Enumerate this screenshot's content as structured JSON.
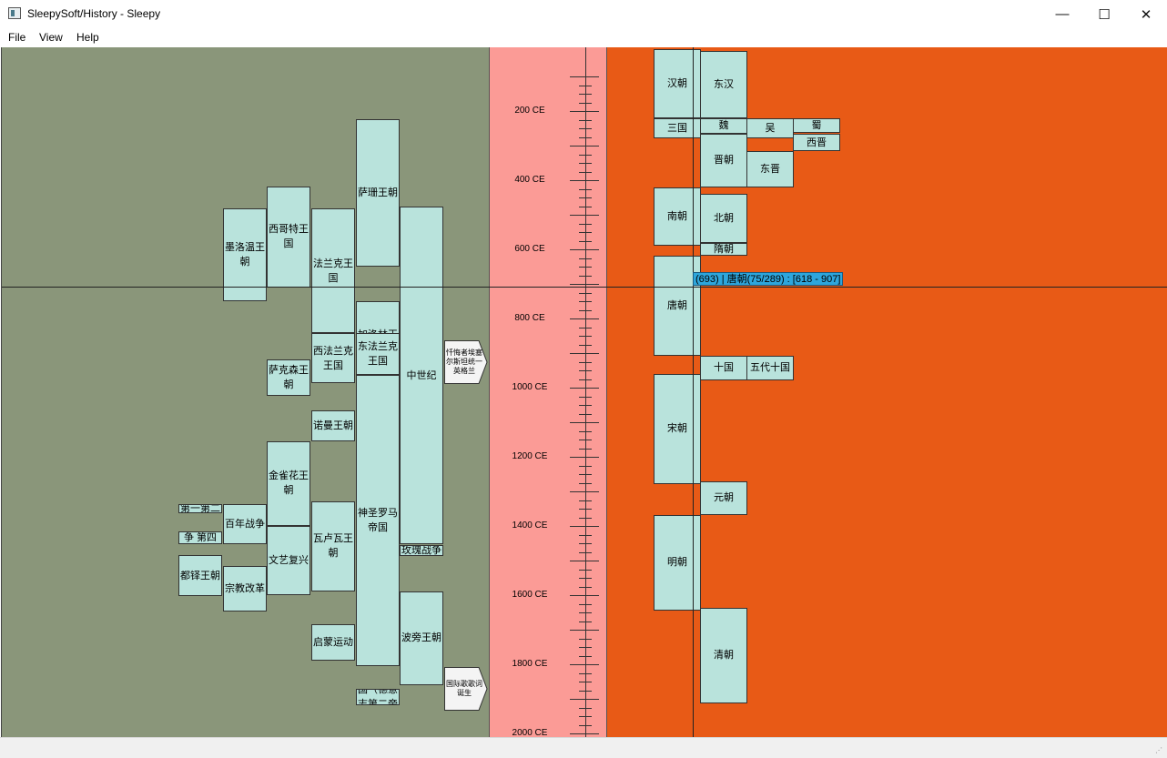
{
  "window": {
    "title": "SleepySoft/History - Sleepy",
    "minimize_glyph": "—",
    "maximize_glyph": "☐",
    "close_glyph": "✕"
  },
  "menu": [
    "File",
    "View",
    "Help"
  ],
  "colors": {
    "left_pane": "#8a967a",
    "axis_pane": "#fb9b96",
    "right_pane": "#e85a16",
    "box_fill": "#b9e3dc",
    "tooltip": "#2ea6dc"
  },
  "axis": {
    "ticks": [
      "200 CE",
      "400 CE",
      "600 CE",
      "800 CE",
      "1000 CE",
      "1200 CE",
      "1400 CE",
      "1600 CE",
      "1800 CE",
      "2000 CE"
    ]
  },
  "tooltip": "(693) | 唐朝(75/289) : [618 - 907]",
  "left_boxes": [
    {
      "label": "萨珊王朝",
      "start": 224,
      "end": 651
    },
    {
      "label": "西哥特王国",
      "start": 418,
      "end": 711
    },
    {
      "label": "墨洛温王朝",
      "start": 481,
      "end": 751
    },
    {
      "label": "法兰克王国",
      "start": 481,
      "end": 843
    },
    {
      "label": "中世纪",
      "start": 476,
      "end": 1453
    },
    {
      "label": "加洛林王朝",
      "start": 751,
      "end": 987
    },
    {
      "label": "东法兰克王国",
      "start": 843,
      "end": 962
    },
    {
      "label": "西法兰克王国",
      "start": 843,
      "end": 987
    },
    {
      "label": "萨克森王朝",
      "start": 919,
      "end": 1024
    },
    {
      "label": "诺曼王朝",
      "start": 1066,
      "end": 1154
    },
    {
      "label": "神圣罗马帝国",
      "start": 962,
      "end": 1806
    },
    {
      "label": "金雀花王朝",
      "start": 1154,
      "end": 1399
    },
    {
      "label": "百年战争",
      "start": 1337,
      "end": 1453
    },
    {
      "label": "瓦卢瓦王朝",
      "start": 1328,
      "end": 1589
    },
    {
      "label": "文艺复兴",
      "start": 1400,
      "end": 1600
    },
    {
      "label": "玫瑰战争",
      "start": 1455,
      "end": 1487
    },
    {
      "label": "都铎王朝",
      "start": 1485,
      "end": 1603
    },
    {
      "label": "宗教改革",
      "start": 1517,
      "end": 1648
    },
    {
      "label": "波旁王朝",
      "start": 1589,
      "end": 1861
    },
    {
      "label": "启蒙运动",
      "start": 1685,
      "end": 1789
    },
    {
      "label": "第一第二",
      "start": 1337,
      "end": 1360
    },
    {
      "label": "争 第四",
      "start": 1415,
      "end": 1453
    },
    {
      "label": "国（德意志第二帝",
      "start": 1871,
      "end": 1918
    }
  ],
  "flags": [
    {
      "label": "忏悔者埃塞尔斯坦统一英格兰",
      "year": 927
    },
    {
      "label": "国际歌歌词诞生",
      "year": 1871
    }
  ],
  "right_boxes": [
    {
      "label": "汉朝",
      "start": -202,
      "end": 220
    },
    {
      "label": "东汉",
      "start": 25,
      "end": 220
    },
    {
      "label": "三国",
      "start": 220,
      "end": 280
    },
    {
      "label": "魏",
      "start": 220,
      "end": 265
    },
    {
      "label": "吴",
      "start": 222,
      "end": 280
    },
    {
      "label": "蜀",
      "start": 221,
      "end": 263
    },
    {
      "label": "西晋",
      "start": 265,
      "end": 317
    },
    {
      "label": "晋朝",
      "start": 266,
      "end": 420
    },
    {
      "label": "东晋",
      "start": 317,
      "end": 420
    },
    {
      "label": "南朝",
      "start": 420,
      "end": 589
    },
    {
      "label": "北朝",
      "start": 439,
      "end": 581
    },
    {
      "label": "隋朝",
      "start": 581,
      "end": 618
    },
    {
      "label": "唐朝",
      "start": 618,
      "end": 907
    },
    {
      "label": "十国",
      "start": 907,
      "end": 979
    },
    {
      "label": "五代十国",
      "start": 907,
      "end": 979
    },
    {
      "label": "宋朝",
      "start": 960,
      "end": 1279
    },
    {
      "label": "元朝",
      "start": 1271,
      "end": 1368
    },
    {
      "label": "明朝",
      "start": 1368,
      "end": 1644
    },
    {
      "label": "清朝",
      "start": 1636,
      "end": 1912
    }
  ]
}
